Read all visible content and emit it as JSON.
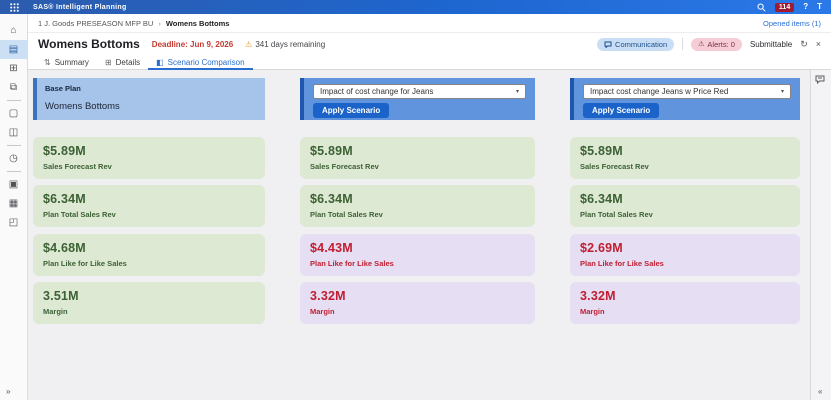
{
  "colors": {
    "accent_blue": "#2a6fd0",
    "topbar_blue": "#1e66d0",
    "badge_red": "#9e1b33",
    "deadline_red": "#c33a31",
    "warning_amber": "#dd9c2e",
    "base_header_bg": "#a6c3e9",
    "scenario_header_bg": "#6094dd",
    "apply_button_bg": "#1b63c9",
    "positive_card_bg": "#dee9d3",
    "positive_card_text": "#3c6134",
    "negative_card_bg": "#e6def3",
    "negative_card_text": "#c01e31"
  },
  "app": {
    "title": "SAS® Intelligent Planning",
    "notification_count": "114",
    "help_label": "?",
    "avatar_label": "T"
  },
  "breadcrumb": {
    "parent": "1 J. Goods PRESEASON MFP BU",
    "separator": "›",
    "current": "Womens Bottoms",
    "opened_items": "Opened items (1)"
  },
  "header": {
    "title": "Womens Bottoms",
    "deadline": "Deadline: Jun 9, 2026",
    "warning_glyph": "⚠",
    "days_remaining": "341 days remaining",
    "communication_label": "Communication",
    "alerts_label": "Alerts: 0",
    "alerts_warning_glyph": "⚠",
    "submittable_label": "Submittable",
    "refresh_glyph": "↻",
    "close_glyph": "×"
  },
  "tabs": [
    {
      "label": "Summary",
      "glyph": "⇅",
      "active": false
    },
    {
      "label": "Details",
      "glyph": "⊞",
      "active": false
    },
    {
      "label": "Scenario Comparison",
      "glyph": "◧",
      "active": true
    }
  ],
  "columns": [
    {
      "type": "base",
      "header_label": "Base Plan",
      "header_name": "Womens Bottoms",
      "cards": [
        {
          "value": "$5.89M",
          "label": "Sales Forecast Rev",
          "tone": "green"
        },
        {
          "value": "$6.34M",
          "label": "Plan Total Sales Rev",
          "tone": "green"
        },
        {
          "value": "$4.68M",
          "label": "Plan Like for Like Sales",
          "tone": "green"
        },
        {
          "value": "3.51M",
          "label": "Margin",
          "tone": "green"
        }
      ]
    },
    {
      "type": "scenario",
      "selected_scenario": "Impact of cost change for Jeans",
      "chevron_glyph": "▾",
      "apply_label": "Apply Scenario",
      "cards": [
        {
          "value": "$5.89M",
          "label": "Sales Forecast Rev",
          "tone": "green"
        },
        {
          "value": "$6.34M",
          "label": "Plan Total Sales Rev",
          "tone": "green"
        },
        {
          "value": "$4.43M",
          "label": "Plan Like for Like Sales",
          "tone": "purple"
        },
        {
          "value": "3.32M",
          "label": "Margin",
          "tone": "purple"
        }
      ]
    },
    {
      "type": "scenario",
      "selected_scenario": "Impact cost change Jeans w Price Red",
      "chevron_glyph": "▾",
      "apply_label": "Apply Scenario",
      "cards": [
        {
          "value": "$5.89M",
          "label": "Sales Forecast Rev",
          "tone": "green"
        },
        {
          "value": "$6.34M",
          "label": "Plan Total Sales Rev",
          "tone": "green"
        },
        {
          "value": "$2.69M",
          "label": "Plan Like for Like Sales",
          "tone": "purple"
        },
        {
          "value": "3.32M",
          "label": "Margin",
          "tone": "purple"
        }
      ]
    }
  ],
  "sidebar": {
    "icons": [
      {
        "name": "home-icon",
        "glyph": "⌂"
      },
      {
        "name": "plan-document-icon",
        "glyph": "▤"
      },
      {
        "name": "workbench-grid-icon",
        "glyph": "⊞"
      },
      {
        "name": "hierarchy-icon",
        "glyph": "⧉"
      },
      {
        "name": "document-icon",
        "glyph": "▢"
      },
      {
        "name": "chart-icon",
        "glyph": "◫"
      },
      {
        "name": "history-clock-icon",
        "glyph": "◷"
      },
      {
        "name": "report-search-icon",
        "glyph": "▣"
      },
      {
        "name": "layers-icon",
        "glyph": "▦"
      },
      {
        "name": "case-icon",
        "glyph": "◰"
      }
    ],
    "expand_glyph": "»"
  },
  "right_rail": {
    "collapse_glyph": "«"
  }
}
